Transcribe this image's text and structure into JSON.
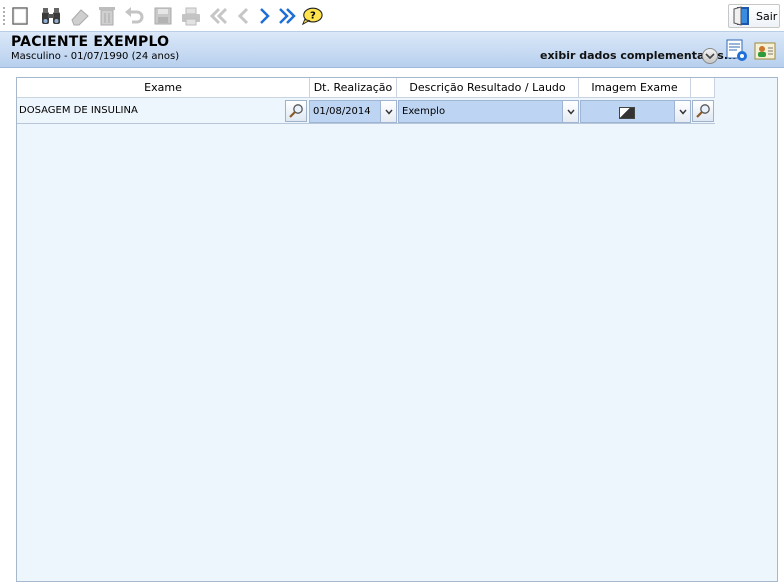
{
  "toolbar": {
    "buttons": [
      {
        "name": "new-icon"
      },
      {
        "name": "search-binoculars-icon"
      },
      {
        "name": "eraser-icon"
      },
      {
        "name": "delete-trash-icon"
      },
      {
        "name": "undo-icon"
      },
      {
        "name": "save-disk-icon"
      },
      {
        "name": "print-icon"
      },
      {
        "name": "first-record-icon"
      },
      {
        "name": "previous-record-icon"
      },
      {
        "name": "next-record-icon"
      },
      {
        "name": "last-record-icon"
      },
      {
        "name": "help-icon"
      }
    ],
    "exit_label": "Sair"
  },
  "patient": {
    "name": "PACIENTE EXEMPLO",
    "details": "Masculino - 01/07/1990 (24 anos)",
    "more_label": "exibir dados complementares..."
  },
  "grid": {
    "columns": [
      "Exame",
      "Dt. Realização",
      "Descrição Resultado / Laudo",
      "Imagem Exame"
    ],
    "rows": [
      {
        "exame": "DOSAGEM DE INSULINA",
        "dt_realizacao": "01/08/2014",
        "descricao": "Exemplo",
        "imagem": "image-thumbnail-icon"
      }
    ]
  },
  "colors": {
    "header_gradient_top": "#dbe8f8",
    "header_gradient_bottom": "#b8d0ee",
    "panel_bg": "#eef6fd",
    "combo_bg": "#bdd4f2",
    "icon_blue": "#1f6fd6"
  }
}
